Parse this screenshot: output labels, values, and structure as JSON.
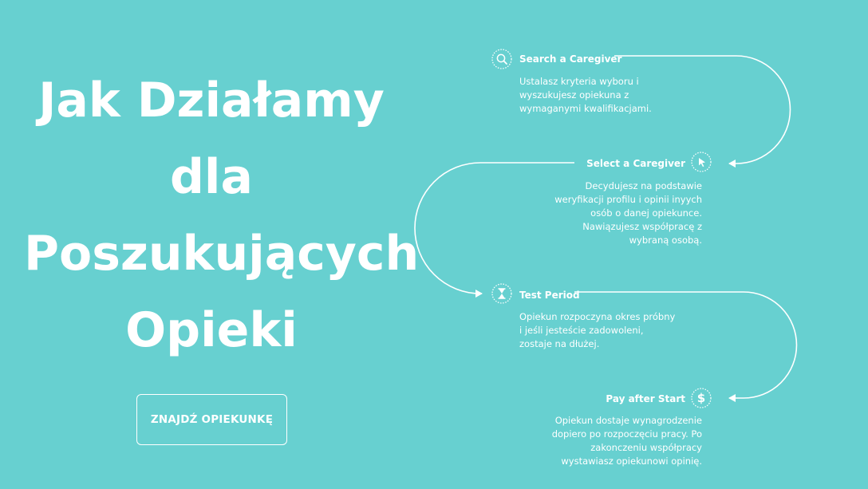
{
  "colors": {
    "background": "#67d0d0",
    "foreground": "#ffffff"
  },
  "hero": {
    "title_lines": [
      "Jak Działamy",
      "dla",
      "Poszukujących",
      "Opieki"
    ],
    "cta_label": "ZNAJDŹ OPIEKUNKĘ"
  },
  "steps": [
    {
      "icon": "search-icon",
      "title": "Search a Caregiver",
      "description_lines": [
        "Ustalasz kryteria wyboru i",
        "wyszukujesz opiekuna z",
        "wymaganymi kwalifikacjami."
      ]
    },
    {
      "icon": "cursor-icon",
      "title": "Select a Caregiver",
      "description_lines": [
        "Decydujesz na podstawie",
        "weryfikacji profilu i opinii inyych",
        "osób o danej opiekunce.",
        "Nawiązujesz współpracę z",
        "wybraną osobą."
      ]
    },
    {
      "icon": "hourglass-icon",
      "title": "Test Period",
      "description_lines": [
        "Opiekun rozpoczyna okres próbny",
        "i jeśli jesteście zadowoleni,",
        "zostaje na dłużej."
      ]
    },
    {
      "icon": "dollar-icon",
      "title": "Pay after Start",
      "description_lines": [
        "Opiekun dostaje wynagrodzenie",
        "dopiero po rozpoczęciu pracy. Po",
        "zakonczeniu współpracy",
        "wystawiasz opiekunowi opinię."
      ]
    }
  ]
}
